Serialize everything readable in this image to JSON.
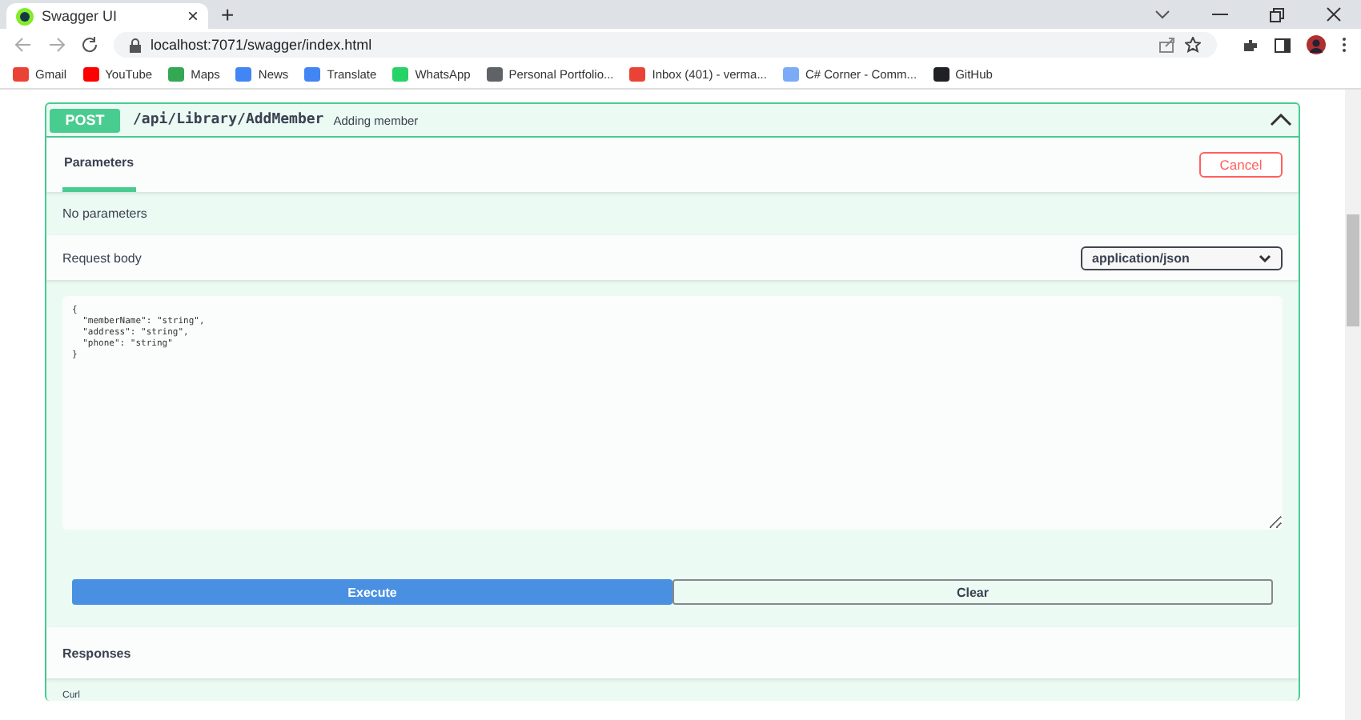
{
  "browser": {
    "tab": {
      "title": "Swagger UI",
      "close": "×",
      "selected": true
    },
    "new_tab": "+",
    "address": "localhost:7071/swagger/index.html",
    "bookmarks": [
      {
        "label": "Gmail",
        "color": "#ea4335"
      },
      {
        "label": "YouTube",
        "color": "#ff0000"
      },
      {
        "label": "Maps",
        "color": "#34a853"
      },
      {
        "label": "News",
        "color": "#4285f4"
      },
      {
        "label": "Translate",
        "color": "#4285f4"
      },
      {
        "label": "WhatsApp",
        "color": "#25d366"
      },
      {
        "label": "Personal Portfolio...",
        "color": "#5f6368"
      },
      {
        "label": "Inbox (401) - verma...",
        "color": "#ea4335"
      },
      {
        "label": "C# Corner - Comm...",
        "color": "#7baaf7"
      },
      {
        "label": "GitHub",
        "color": "#202124"
      }
    ]
  },
  "operation": {
    "method": "POST",
    "path": "/api/Library/AddMember",
    "summary": "Adding member",
    "expanded": true
  },
  "parameters": {
    "tab": {
      "label": "Parameters",
      "selected": true
    },
    "cancel": "Cancel",
    "empty": "No parameters"
  },
  "request_body": {
    "label": "Request body",
    "content_type": "application/json",
    "value": "{\n  \"memberName\": \"string\",\n  \"address\": \"string\",\n  \"phone\": \"string\"\n}"
  },
  "buttons": [
    {
      "label": "Execute",
      "kind": "primary"
    },
    {
      "label": "Clear",
      "kind": "secondary"
    }
  ],
  "responses": {
    "title": "Responses",
    "curl": "Curl"
  }
}
